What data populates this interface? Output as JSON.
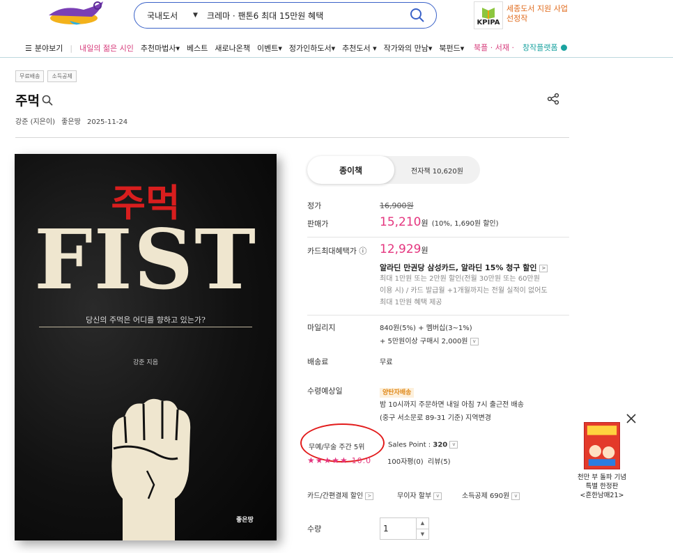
{
  "header": {
    "search_category": "국내도서",
    "search_query": "크레마 · 팬톤6 최대 15만원 혜택",
    "kpipa_label": "KPIPA",
    "kpipa_text": "세종도서 지원 사업 선정작"
  },
  "nav": {
    "items": [
      "분야보기",
      "내일의 젊은 시인",
      "추천마법사▾",
      "베스트",
      "새로나온책",
      "이벤트▾",
      "정가인하도서▾",
      "추천도서 ▾",
      "작가와의 만남▾",
      "북펀드▾"
    ],
    "right_a": "북플 · 서재 ·",
    "right_b": "창작플랫폼"
  },
  "book": {
    "badges": [
      "무료배송",
      "소득공제"
    ],
    "title": "주먹",
    "author": "강준 (지은이)",
    "publisher": "좋은땅",
    "date": "2025-11-24",
    "cover": {
      "title_kr": "주먹",
      "title_en": "FIST",
      "subtitle": "당신의 주먹은 어디를 향하고 있는가?",
      "author": "강준 지음",
      "publisher": "좋은땅"
    }
  },
  "format": {
    "paper": "종이책",
    "ebook": "전자책 10,620원"
  },
  "price": {
    "list_label": "정가",
    "list_value": "16,900원",
    "sale_label": "판매가",
    "sale_value": "15,210",
    "sale_unit": "원",
    "sale_note": "(10%, 1,690원 할인)",
    "card_label": "카드최대혜택가",
    "card_value": "12,929",
    "card_unit": "원",
    "card_promo": "알라딘 만권당 삼성카드, 알라딘 15% 청구 할인",
    "card_detail_1": "최대 1만원 또는 2만원 할인(전월 30만원 또는 60만원",
    "card_detail_2": "이용 시) / 카드 발급월 +1개월까지는 전월 실적이 없어도",
    "card_detail_3": "최대 1만원 혜택 제공"
  },
  "mileage": {
    "label": "마일리지",
    "line1": "840원(5%) + 멤버십(3~1%)",
    "line2": "+ 5만원이상 구매시 2,000원"
  },
  "shipping": {
    "label": "배송료",
    "value": "무료"
  },
  "delivery": {
    "label": "수령예상일",
    "tag": "양탄자배송",
    "line1": "밤 10시까지 주문하면 내일 아침 7시 출근전 배송",
    "line2": "(중구 서소문로 89-31 기준) 지역변경"
  },
  "rank": {
    "text": "무예/무술 주간 5위",
    "sales_point_label": "Sales Point :",
    "sales_point_value": "320",
    "stars": "★★★★★",
    "rating": "10.0",
    "review_100": "100자평(0)",
    "review": "리뷰(5)"
  },
  "payment": {
    "card": "카드/간편결제 할인",
    "installment": "무이자 할부",
    "deduction": "소득공제 690원"
  },
  "quantity": {
    "label": "수량",
    "value": "1"
  },
  "ad": {
    "line1": "천만 부 돌파 기념",
    "line2": "특별 한정판",
    "line3": "<흔한남매21>"
  }
}
